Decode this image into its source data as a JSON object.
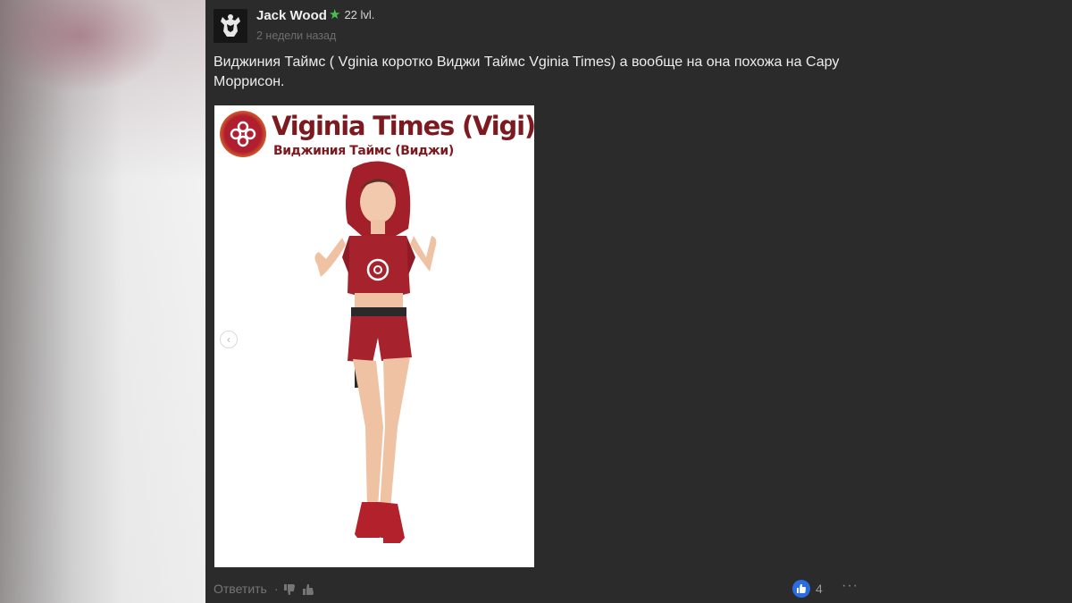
{
  "comment": {
    "author": "Jack Wood",
    "level": "22 lvl.",
    "timestamp": "2 недели назад",
    "text": "Виджиния Таймс ( Vginia коротко Виджи Таймс Vginia Times) а вообще на она похожа на Сару Моррисон.",
    "attachment": {
      "title": "Viginia Times (Vigi)",
      "subtitle": "Виджиния Таймс (Виджи)"
    },
    "actions": {
      "reply_label": "Ответить",
      "separator": "·",
      "likes": "4",
      "more": "···"
    }
  },
  "colors": {
    "background": "#2b2b2b",
    "level_star": "#49c24d",
    "like_badge": "#2a6de3",
    "brand": "#7d1a1f"
  },
  "icons": [
    "avatar",
    "star-icon",
    "thumbs-down-icon",
    "thumbs-up-icon",
    "like-badge-icon",
    "more-icon",
    "chevron-left-icon"
  ]
}
